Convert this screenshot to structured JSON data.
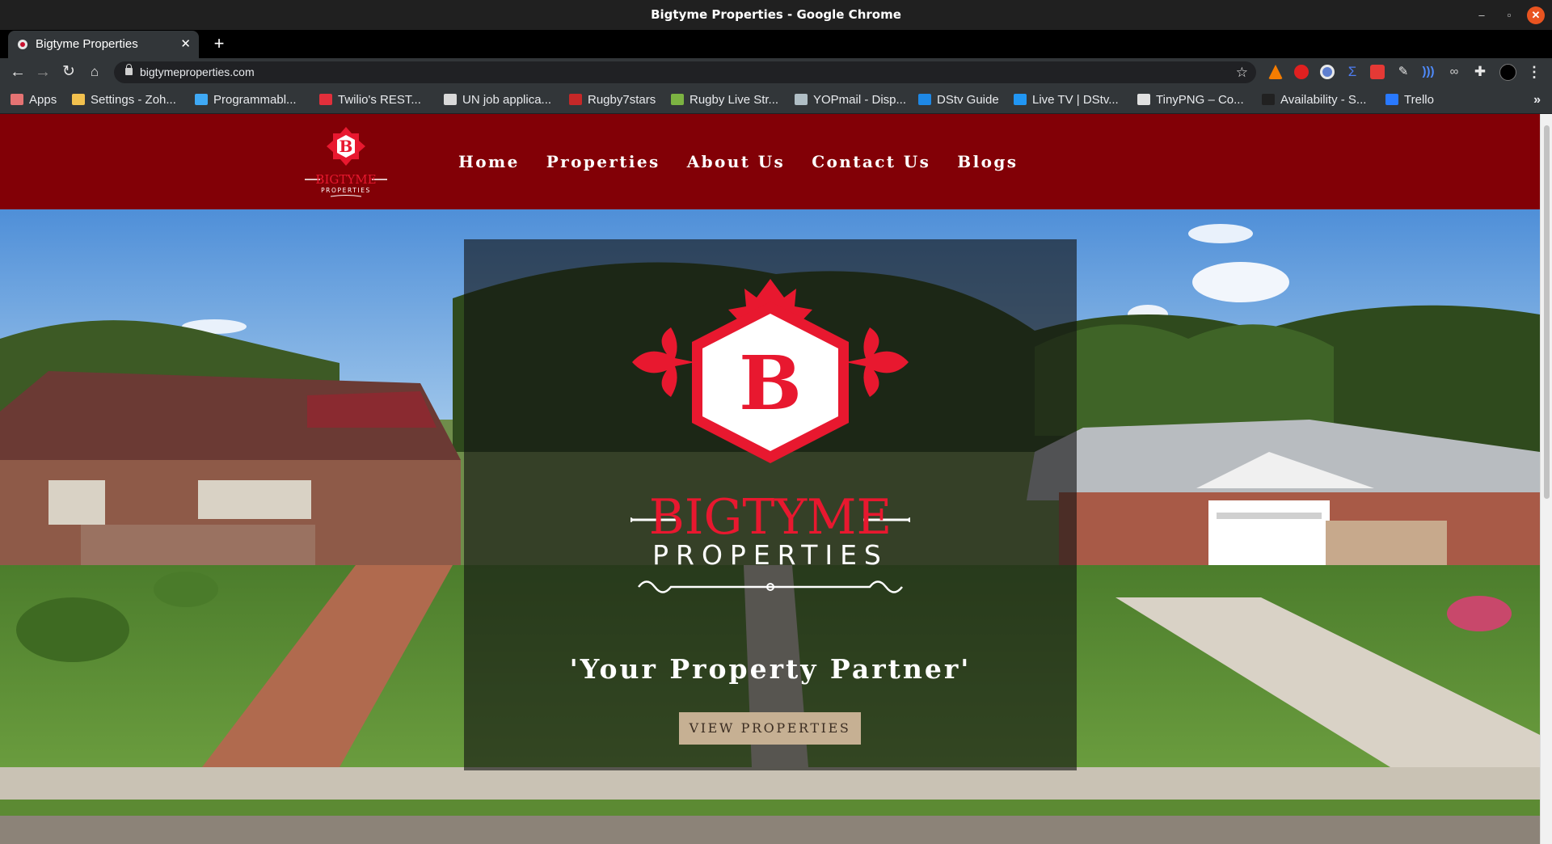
{
  "window": {
    "title": "Bigtyme Properties - Google Chrome",
    "controls": {
      "minimize": "–",
      "maximize": "▫",
      "close": "✕"
    }
  },
  "tabs": [
    {
      "label": "Bigtyme Properties",
      "active": true,
      "close": "✕"
    }
  ],
  "new_tab": "+",
  "toolbar": {
    "back": "←",
    "forward": "→",
    "reload": "↻",
    "home": "⌂",
    "url": "bigtymeproperties.com",
    "bookmark_star": "☆",
    "menu": "⋮"
  },
  "bookmarks": [
    {
      "label": "Apps",
      "icon": "apps-grid-icon",
      "color": "#e57373"
    },
    {
      "label": "Settings - Zoh...",
      "icon": "briefcase-icon",
      "color": "#f2c14e"
    },
    {
      "label": "Programmabl...",
      "icon": "star-burst-icon",
      "color": "#3fa9f5"
    },
    {
      "label": "Twilio's REST...",
      "icon": "twilio-icon",
      "color": "#e22f3b"
    },
    {
      "label": "UN job applica...",
      "icon": "un-icon",
      "color": "#d9d9d9"
    },
    {
      "label": "Rugby7stars",
      "icon": "rugby-shield-icon",
      "color": "#c62828"
    },
    {
      "label": "Rugby Live Str...",
      "icon": "slash-icon",
      "color": "#7cb342"
    },
    {
      "label": "YOPmail - Disp...",
      "icon": "yopmail-icon",
      "color": "#b0bec5"
    },
    {
      "label": "DStv Guide",
      "icon": "dstv-icon",
      "color": "#1e88e5"
    },
    {
      "label": "Live TV | DStv...",
      "icon": "play-icon",
      "color": "#2196f3"
    },
    {
      "label": "TinyPNG – Co...",
      "icon": "panda-icon",
      "color": "#e0e0e0"
    },
    {
      "label": "Availability - S...",
      "icon": "circle-icon",
      "color": "#212121"
    },
    {
      "label": "Trello",
      "icon": "trello-icon",
      "color": "#2979ff"
    }
  ],
  "bookmarks_more": "»",
  "site": {
    "brand": "BIGTYME",
    "brand_sub": "PROPERTIES",
    "monogram": "B",
    "nav": [
      "Home",
      "Properties",
      "About Us",
      "Contact Us",
      "Blogs"
    ],
    "tagline": "'Your Property Partner'",
    "cta": "VIEW PROPERTIES"
  },
  "colors": {
    "header_red": "#820006",
    "brand_red": "#e8182f",
    "cta_bg": "#c6b093",
    "cta_text": "#3b2d22"
  }
}
